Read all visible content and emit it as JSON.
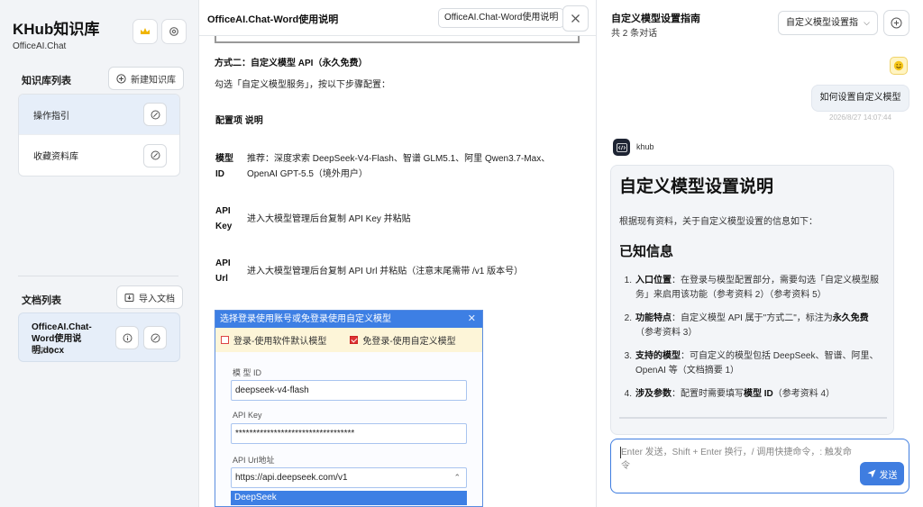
{
  "sidebar": {
    "brand_title": "KHub知识库",
    "brand_subtitle": "OfficeAI.Chat",
    "kb_section_label": "知识库列表",
    "new_kb_label": "新建知识库",
    "kb_items": [
      {
        "label": "操作指引",
        "active": true
      },
      {
        "label": "收藏资料库",
        "active": false
      }
    ],
    "doc_section_label": "文档列表",
    "import_doc_label": "导入文档",
    "doc": {
      "name": "OfficeAI.Chat-Word使用说明.docx",
      "status": "已学习"
    }
  },
  "viewer": {
    "title": "OfficeAI.Chat-Word使用说明",
    "chip": "OfficeAI.Chat-Word使用说明",
    "heading": "方式二：自定义模型 API（永久免费）",
    "intro": "勾选「自定义模型服务」，按以下步骤配置：",
    "config_header": "配置项 说明",
    "config_rows": [
      {
        "key": "模型 ID",
        "value": "推荐：深度求索 DeepSeek-V4-Flash、智谱 GLM5.1、阿里 Qwen3.7-Max、OpenAI GPT-5.5（境外用户）"
      },
      {
        "key": "API Key",
        "value": "进入大模型管理后台复制 API Key 并粘贴"
      },
      {
        "key": "API Url",
        "value": "进入大模型管理后台复制 API Url 并粘贴（注意末尾需带 /v1 版本号）"
      }
    ],
    "dialog": {
      "title": "选择登录使用账号或免登录使用自定义模型",
      "close_glyph": "✕",
      "option_login": "登录-使用软件默认模型",
      "option_custom": "免登录-使用自定义模型",
      "model_id_label": "模 型 ID",
      "model_id_value": "deepseek-v4-flash",
      "api_key_label": "API Key",
      "api_key_value": "**********************************",
      "api_url_label": "API Url地址",
      "api_url_value": "https://api.deepseek.com/v1",
      "dropdown_option": "DeepSeek"
    }
  },
  "chat": {
    "title": "自定义模型设置指南",
    "count": "共 2 条对话",
    "model_select": "自定义模型设置指",
    "user_message": "如何设置自定义模型",
    "user_time": "2026/8/27 14:07:44",
    "bot_name": "khub",
    "answer": {
      "h1": "自定义模型设置说明",
      "intro": "根据现有资料，关于自定义模型设置的信息如下：",
      "h2": "已知信息",
      "items": [
        {
          "num": "1.",
          "bold": "入口位置",
          "text": "：在登录与模型配置部分，需要勾选「自定义模型服务」来启用该功能（参考资料 2）（参考资料 5）"
        },
        {
          "num": "2.",
          "bold": "功能特点",
          "text": "：自定义模型 API 属于\"方式二\"，标注为",
          "bold2": "永久免费",
          "text2": "（参考资料 3）"
        },
        {
          "num": "3.",
          "bold": "支持的模型",
          "text": "：可自定义的模型包括 DeepSeek、智谱、阿里、OpenAI 等（文档摘要 1）"
        },
        {
          "num": "4.",
          "bold": "涉及参数",
          "text": "：配置时需要填写",
          "bold2": "模型 ID",
          "text2": "（参考资料 4）"
        }
      ]
    },
    "composer_placeholder": "Enter 发送，Shift + Enter 换行，/ 调用快捷命令，: 触发命令",
    "send_label": "发送"
  },
  "icons": {
    "crown": "crown-icon",
    "settings": "settings-icon",
    "plus": "plus-icon",
    "remove": "remove-icon",
    "import": "import-icon",
    "info": "info-icon",
    "close": "close-icon",
    "send": "send-icon"
  },
  "colors": {
    "accent": "#3f7de0",
    "active_item": "#e6eef9",
    "dialog_header": "#3d7fe4",
    "checkbox": "#d33"
  }
}
